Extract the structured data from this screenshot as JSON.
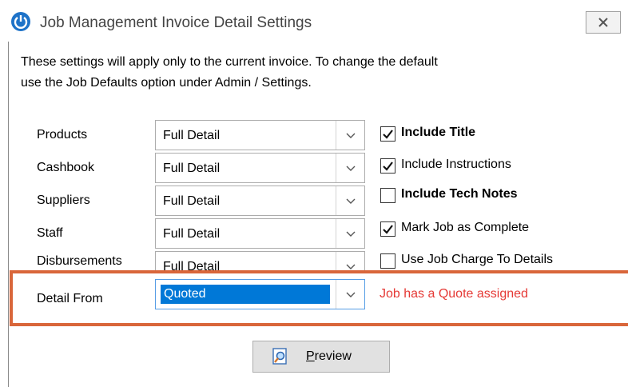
{
  "window": {
    "title": "Job Management Invoice Detail Settings",
    "close_glyph": "close-icon"
  },
  "intro": {
    "line1": "These settings will apply only to the current invoice.  To change the default",
    "line2": "use the Job Defaults option under Admin / Settings."
  },
  "rows": [
    {
      "label": "Products",
      "value": "Full Detail"
    },
    {
      "label": "Cashbook",
      "value": "Full Detail"
    },
    {
      "label": "Suppliers",
      "value": "Full Detail"
    },
    {
      "label": "Staff",
      "value": "Full Detail"
    },
    {
      "label": "Disbursements",
      "value": "Full Detail"
    },
    {
      "label": "Detail From",
      "value": "Quoted"
    }
  ],
  "checks": [
    {
      "label": "Include Title",
      "checked": true,
      "bold": true
    },
    {
      "label": "Include Instructions",
      "checked": true,
      "bold": false
    },
    {
      "label": "Include Tech Notes",
      "checked": false,
      "bold": true
    },
    {
      "label": "Mark Job as Complete",
      "checked": true,
      "bold": false
    },
    {
      "label": "Use Job Charge To Details",
      "checked": false,
      "bold": false
    }
  ],
  "note": "Job has a Quote assigned",
  "preview": {
    "mnemonic": "P",
    "rest": "review"
  },
  "colors": {
    "highlight": "#d9663a",
    "note": "#e53935",
    "selection": "#0078d7",
    "app_icon": "#1e73c8"
  }
}
